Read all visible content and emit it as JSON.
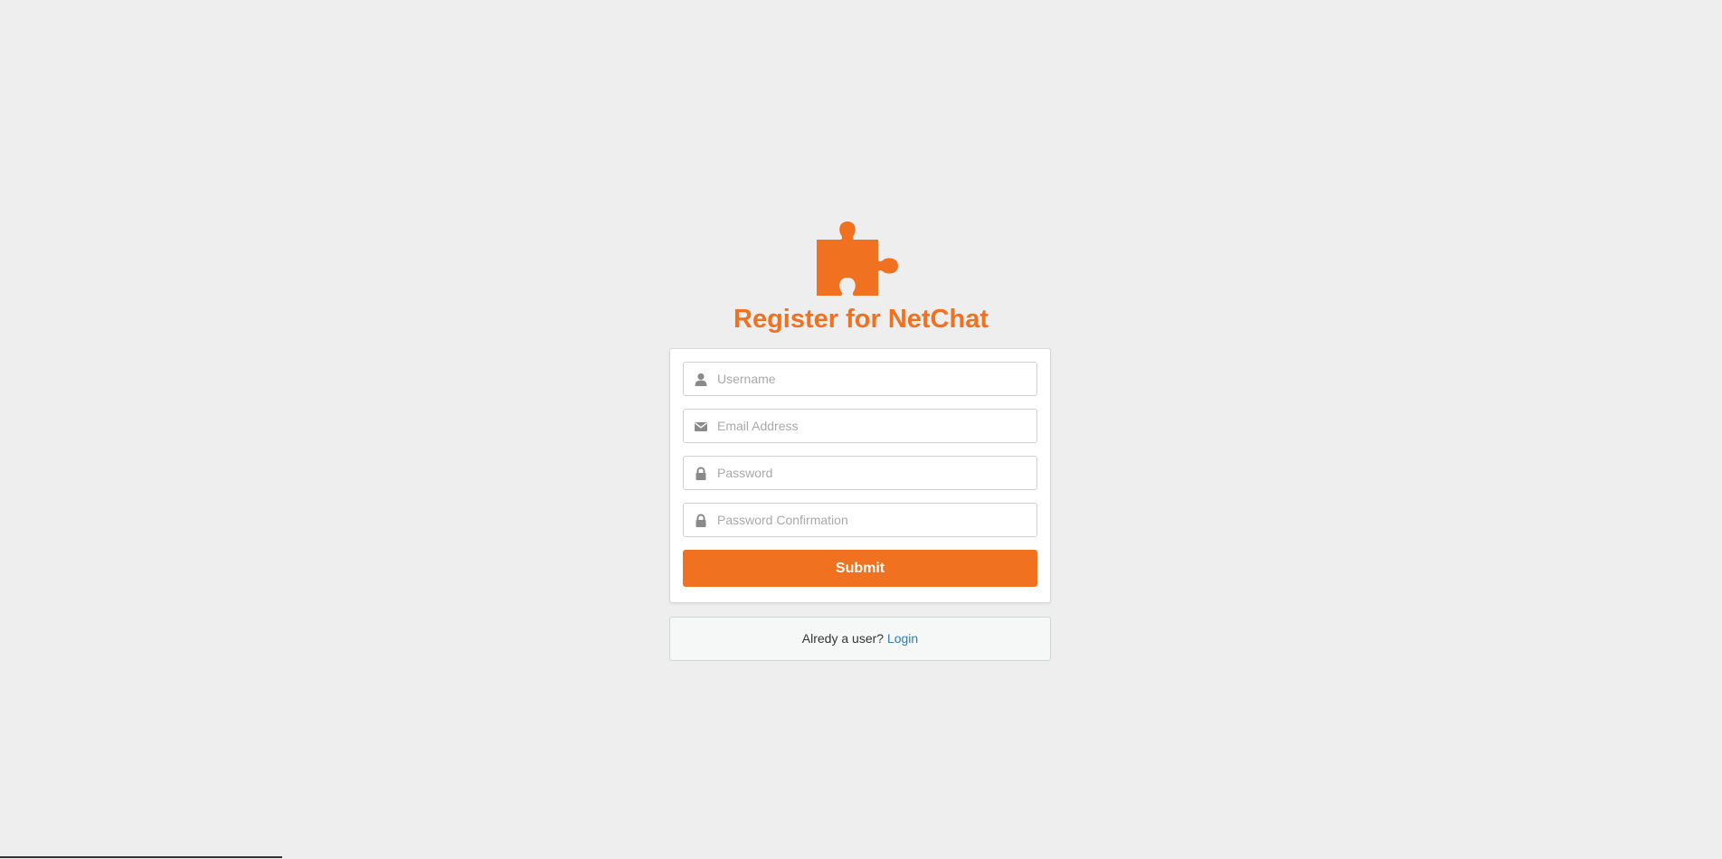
{
  "colors": {
    "accent": "#f07120",
    "page_background": "#eeeeee",
    "link": "#337ab7"
  },
  "header": {
    "logo_icon": "puzzle-piece-icon",
    "title": "Register for NetChat"
  },
  "form": {
    "username": {
      "icon": "user-icon",
      "placeholder": "Username",
      "value": ""
    },
    "email": {
      "icon": "envelope-icon",
      "placeholder": "Email Address",
      "value": ""
    },
    "password": {
      "icon": "lock-icon",
      "placeholder": "Password",
      "value": ""
    },
    "password_confirmation": {
      "icon": "lock-icon",
      "placeholder": "Password Confirmation",
      "value": ""
    },
    "submit_label": "Submit"
  },
  "footer": {
    "prompt": "Alredy a user?",
    "login_link": "Login"
  }
}
